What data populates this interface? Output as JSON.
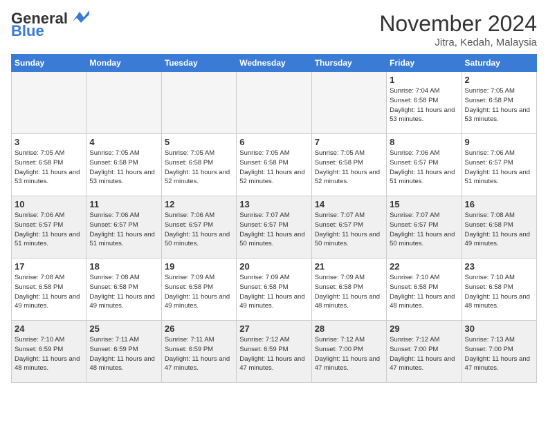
{
  "header": {
    "logo_general": "General",
    "logo_blue": "Blue",
    "month": "November 2024",
    "location": "Jitra, Kedah, Malaysia"
  },
  "days_of_week": [
    "Sunday",
    "Monday",
    "Tuesday",
    "Wednesday",
    "Thursday",
    "Friday",
    "Saturday"
  ],
  "weeks": [
    [
      {
        "day": "",
        "empty": true
      },
      {
        "day": "",
        "empty": true
      },
      {
        "day": "",
        "empty": true
      },
      {
        "day": "",
        "empty": true
      },
      {
        "day": "",
        "empty": true
      },
      {
        "day": "1",
        "sunrise": "7:04 AM",
        "sunset": "6:58 PM",
        "daylight": "11 hours and 53 minutes."
      },
      {
        "day": "2",
        "sunrise": "7:05 AM",
        "sunset": "6:58 PM",
        "daylight": "11 hours and 53 minutes."
      }
    ],
    [
      {
        "day": "3",
        "sunrise": "7:05 AM",
        "sunset": "6:58 PM",
        "daylight": "11 hours and 53 minutes."
      },
      {
        "day": "4",
        "sunrise": "7:05 AM",
        "sunset": "6:58 PM",
        "daylight": "11 hours and 53 minutes."
      },
      {
        "day": "5",
        "sunrise": "7:05 AM",
        "sunset": "6:58 PM",
        "daylight": "11 hours and 52 minutes."
      },
      {
        "day": "6",
        "sunrise": "7:05 AM",
        "sunset": "6:58 PM",
        "daylight": "11 hours and 52 minutes."
      },
      {
        "day": "7",
        "sunrise": "7:05 AM",
        "sunset": "6:58 PM",
        "daylight": "11 hours and 52 minutes."
      },
      {
        "day": "8",
        "sunrise": "7:06 AM",
        "sunset": "6:57 PM",
        "daylight": "11 hours and 51 minutes."
      },
      {
        "day": "9",
        "sunrise": "7:06 AM",
        "sunset": "6:57 PM",
        "daylight": "11 hours and 51 minutes."
      }
    ],
    [
      {
        "day": "10",
        "sunrise": "7:06 AM",
        "sunset": "6:57 PM",
        "daylight": "11 hours and 51 minutes."
      },
      {
        "day": "11",
        "sunrise": "7:06 AM",
        "sunset": "6:57 PM",
        "daylight": "11 hours and 51 minutes."
      },
      {
        "day": "12",
        "sunrise": "7:06 AM",
        "sunset": "6:57 PM",
        "daylight": "11 hours and 50 minutes."
      },
      {
        "day": "13",
        "sunrise": "7:07 AM",
        "sunset": "6:57 PM",
        "daylight": "11 hours and 50 minutes."
      },
      {
        "day": "14",
        "sunrise": "7:07 AM",
        "sunset": "6:57 PM",
        "daylight": "11 hours and 50 minutes."
      },
      {
        "day": "15",
        "sunrise": "7:07 AM",
        "sunset": "6:57 PM",
        "daylight": "11 hours and 50 minutes."
      },
      {
        "day": "16",
        "sunrise": "7:08 AM",
        "sunset": "6:58 PM",
        "daylight": "11 hours and 49 minutes."
      }
    ],
    [
      {
        "day": "17",
        "sunrise": "7:08 AM",
        "sunset": "6:58 PM",
        "daylight": "11 hours and 49 minutes."
      },
      {
        "day": "18",
        "sunrise": "7:08 AM",
        "sunset": "6:58 PM",
        "daylight": "11 hours and 49 minutes."
      },
      {
        "day": "19",
        "sunrise": "7:09 AM",
        "sunset": "6:58 PM",
        "daylight": "11 hours and 49 minutes."
      },
      {
        "day": "20",
        "sunrise": "7:09 AM",
        "sunset": "6:58 PM",
        "daylight": "11 hours and 49 minutes."
      },
      {
        "day": "21",
        "sunrise": "7:09 AM",
        "sunset": "6:58 PM",
        "daylight": "11 hours and 48 minutes."
      },
      {
        "day": "22",
        "sunrise": "7:10 AM",
        "sunset": "6:58 PM",
        "daylight": "11 hours and 48 minutes."
      },
      {
        "day": "23",
        "sunrise": "7:10 AM",
        "sunset": "6:58 PM",
        "daylight": "11 hours and 48 minutes."
      }
    ],
    [
      {
        "day": "24",
        "sunrise": "7:10 AM",
        "sunset": "6:59 PM",
        "daylight": "11 hours and 48 minutes."
      },
      {
        "day": "25",
        "sunrise": "7:11 AM",
        "sunset": "6:59 PM",
        "daylight": "11 hours and 48 minutes."
      },
      {
        "day": "26",
        "sunrise": "7:11 AM",
        "sunset": "6:59 PM",
        "daylight": "11 hours and 47 minutes."
      },
      {
        "day": "27",
        "sunrise": "7:12 AM",
        "sunset": "6:59 PM",
        "daylight": "11 hours and 47 minutes."
      },
      {
        "day": "28",
        "sunrise": "7:12 AM",
        "sunset": "7:00 PM",
        "daylight": "11 hours and 47 minutes."
      },
      {
        "day": "29",
        "sunrise": "7:12 AM",
        "sunset": "7:00 PM",
        "daylight": "11 hours and 47 minutes."
      },
      {
        "day": "30",
        "sunrise": "7:13 AM",
        "sunset": "7:00 PM",
        "daylight": "11 hours and 47 minutes."
      }
    ]
  ]
}
